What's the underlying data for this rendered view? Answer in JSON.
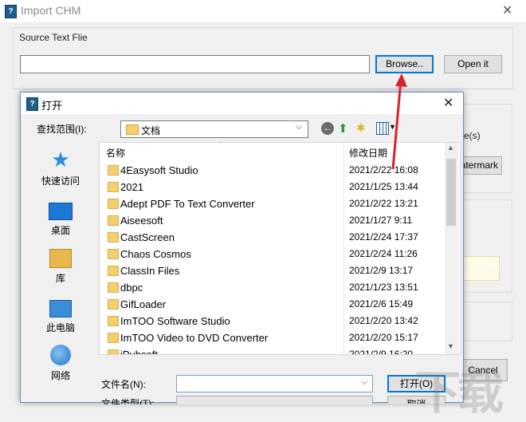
{
  "background_window": {
    "title": "Import CHM",
    "close_glyph": "✕",
    "group_label": "Source Text Flie",
    "source_input_value": "",
    "browse_label": "Browse..",
    "open_it_label": "Open it",
    "partial_label_e": "e(s)",
    "watermark_button_label": "atermark",
    "cancel_label": "Cancel"
  },
  "dialog": {
    "title": "打开",
    "close_glyph": "✕",
    "look_in_label": "查找范围(I):",
    "look_in_value": "文档",
    "places": [
      {
        "label": "快速访问",
        "icon": "star-icon"
      },
      {
        "label": "桌面",
        "icon": "desktop-icon"
      },
      {
        "label": "库",
        "icon": "library-icon"
      },
      {
        "label": "此电脑",
        "icon": "computer-icon"
      },
      {
        "label": "网络",
        "icon": "network-icon"
      }
    ],
    "columns": {
      "name": "名称",
      "date": "修改日期"
    },
    "files": [
      {
        "name": "4Easysoft Studio",
        "date": "2021/2/22 16:08"
      },
      {
        "name": "2021",
        "date": "2021/1/25 13:44"
      },
      {
        "name": "Adept PDF To Text Converter",
        "date": "2021/2/22 13:21"
      },
      {
        "name": "Aiseesoft",
        "date": "2021/1/27 9:11"
      },
      {
        "name": "CastScreen",
        "date": "2021/2/24 17:37"
      },
      {
        "name": "Chaos Cosmos",
        "date": "2021/2/24 11:26"
      },
      {
        "name": "ClassIn Files",
        "date": "2021/2/9 13:17"
      },
      {
        "name": "dbpc",
        "date": "2021/1/23 13:51"
      },
      {
        "name": "GifLoader",
        "date": "2021/2/6 15:49"
      },
      {
        "name": "ImTOO Software Studio",
        "date": "2021/2/20 13:42"
      },
      {
        "name": "ImTOO Video to DVD Converter",
        "date": "2021/2/20 15:17"
      },
      {
        "name": "iPubsoft",
        "date": "2021/2/9 16:20"
      }
    ],
    "filename_label": "文件名(N):",
    "filename_value": "",
    "open_label": "打开(O)",
    "filetype_label": "文件类型(T):",
    "cancel_label": "取消"
  },
  "colors": {
    "accent": "#0078d7",
    "annotation_arrow": "#d9232a",
    "folder": "#f5cf6b"
  }
}
